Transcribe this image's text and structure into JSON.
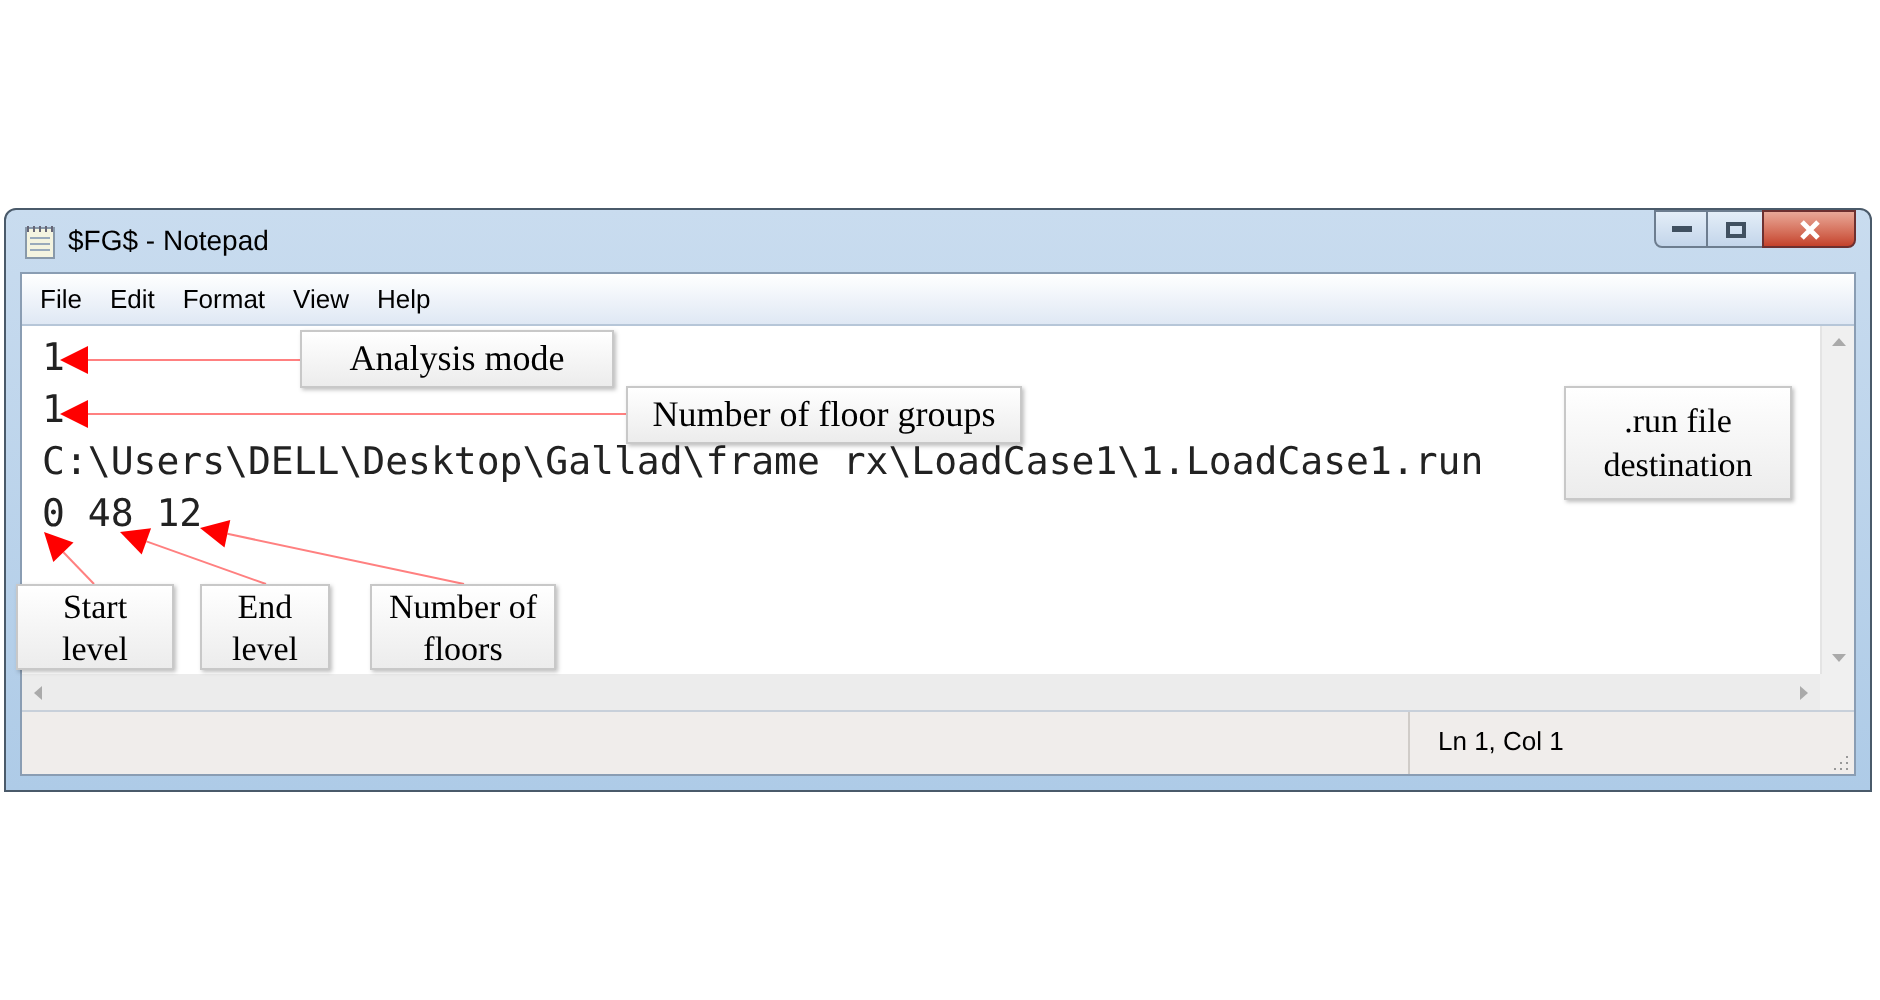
{
  "window": {
    "title": "$FG$ - Notepad"
  },
  "menu": [
    "File",
    "Edit",
    "Format",
    "View",
    "Help"
  ],
  "editor": {
    "lines": [
      "1",
      "1",
      "C:\\Users\\DELL\\Desktop\\Gallad\\frame rx\\LoadCase1\\1.LoadCase1.run",
      "0 48 12"
    ]
  },
  "status_bar": {
    "position": "Ln 1, Col 1"
  },
  "callouts": [
    {
      "text": "Analysis mode"
    },
    {
      "text": "Number of floor groups"
    },
    {
      "text": ".run file destination"
    },
    {
      "text": "Start level"
    },
    {
      "text": "End level"
    },
    {
      "text": "Number of floors"
    }
  ]
}
